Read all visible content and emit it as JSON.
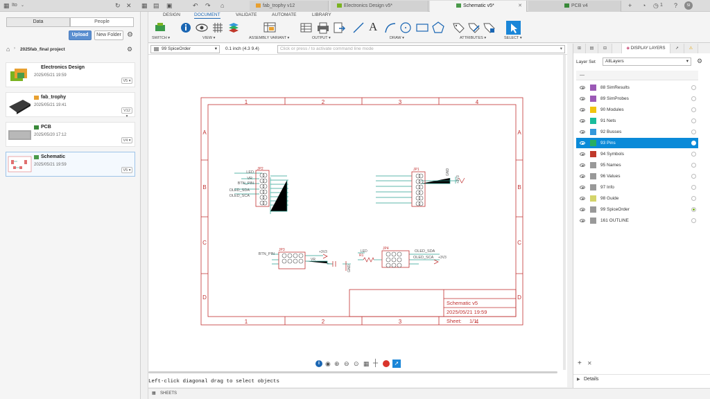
{
  "topbar": {
    "user_name": "Ito",
    "tabs": [
      {
        "label": "fab_trophy v12",
        "active": false
      },
      {
        "label": "Electronics Design v5*",
        "active": false
      },
      {
        "label": "Schematic v5*",
        "active": true
      },
      {
        "label": "PCB v4",
        "active": false
      }
    ],
    "notification_count": "1",
    "avatar_initials": "SI"
  },
  "data_panel": {
    "segments": [
      "Data",
      "People"
    ],
    "upload_label": "Upload",
    "new_folder_label": "New Folder",
    "breadcrumb": "2025fab_final project",
    "items": [
      {
        "name": "Electronics Design",
        "date": "2025/05/21 19:59",
        "version": "V5"
      },
      {
        "name": "fab_trophy",
        "date": "2025/05/21 19:41",
        "version": "V12"
      },
      {
        "name": "PCB",
        "date": "2025/05/20 17:12",
        "version": "V4"
      },
      {
        "name": "Schematic",
        "date": "2025/05/21 19:59",
        "version": "V5"
      }
    ]
  },
  "ribbon": {
    "tabs": [
      "DESIGN",
      "DOCUMENT",
      "VALIDATE",
      "AUTOMATE",
      "LIBRARY"
    ],
    "active_tab": "DOCUMENT",
    "groups": [
      "SWITCH",
      "VIEW",
      "ASSEMBLY VARIANT",
      "OUTPUT",
      "DRAW",
      "ATTRIBUTES",
      "SELECT"
    ]
  },
  "command_bar": {
    "layer_select": "99 SpiceOrder",
    "grid": "0.1 inch (4.3 9.4)",
    "command_placeholder": "Click or press / to activate command line mode"
  },
  "schematic": {
    "col_labels": [
      "1",
      "2",
      "3",
      "4"
    ],
    "row_labels": [
      "A",
      "B",
      "C",
      "D"
    ],
    "title_block": {
      "title": "Schematic v5",
      "date": "2025/05/21 19:59",
      "sheet_label": "Sheet:",
      "sheet_value": "1/1"
    },
    "parts": {
      "jp2": "JP2",
      "jp1": "JP1",
      "jp3": "JP3",
      "jp4": "JP4",
      "r1": "R1",
      "jp2_nets": [
        "LED",
        "VR",
        "BTN_PIN",
        "OLED_SDA",
        "OLED_SCA"
      ],
      "jp1_nets": [
        "GND",
        "+3V3"
      ],
      "jp3_nets": [
        "BTN_PIN",
        "+3V3",
        "VR"
      ],
      "jp4_nets": [
        "LED",
        "OLED_SDA",
        "OLED_SCA",
        "+3V3"
      ],
      "gnd": "GND"
    }
  },
  "status": {
    "message": "Left-click diagonal drag to select objects",
    "sheets_label": "SHEETS"
  },
  "layers_panel": {
    "tab_label": "DISPLAY LAYERS",
    "layer_set_label": "Layer Set",
    "layer_set_value": "AllLayers",
    "layers": [
      {
        "id": "88",
        "name": "SimResults",
        "color": "#9b59b6",
        "selected": false,
        "active": false
      },
      {
        "id": "89",
        "name": "SimProbes",
        "color": "#9b59b6",
        "selected": false,
        "active": false
      },
      {
        "id": "90",
        "name": "Modules",
        "color": "#f1c40f",
        "selected": false,
        "active": false
      },
      {
        "id": "91",
        "name": "Nets",
        "color": "#1abc9c",
        "selected": false,
        "active": false
      },
      {
        "id": "92",
        "name": "Busses",
        "color": "#3498db",
        "selected": false,
        "active": false
      },
      {
        "id": "93",
        "name": "Pins",
        "color": "#27ae60",
        "selected": true,
        "active": false
      },
      {
        "id": "94",
        "name": "Symbols",
        "color": "#c0392b",
        "selected": false,
        "active": false
      },
      {
        "id": "95",
        "name": "Names",
        "color": "#999999",
        "selected": false,
        "active": false
      },
      {
        "id": "96",
        "name": "Values",
        "color": "#999999",
        "selected": false,
        "active": false
      },
      {
        "id": "97",
        "name": "Info",
        "color": "#999999",
        "selected": false,
        "active": false
      },
      {
        "id": "98",
        "name": "Guide",
        "color": "#d4d46a",
        "selected": false,
        "active": false
      },
      {
        "id": "99",
        "name": "SpiceOrder",
        "color": "#999999",
        "selected": false,
        "active": true
      },
      {
        "id": "161",
        "name": "OUTLINE",
        "color": "#999999",
        "selected": false,
        "active": false
      }
    ],
    "details_label": "Details"
  }
}
